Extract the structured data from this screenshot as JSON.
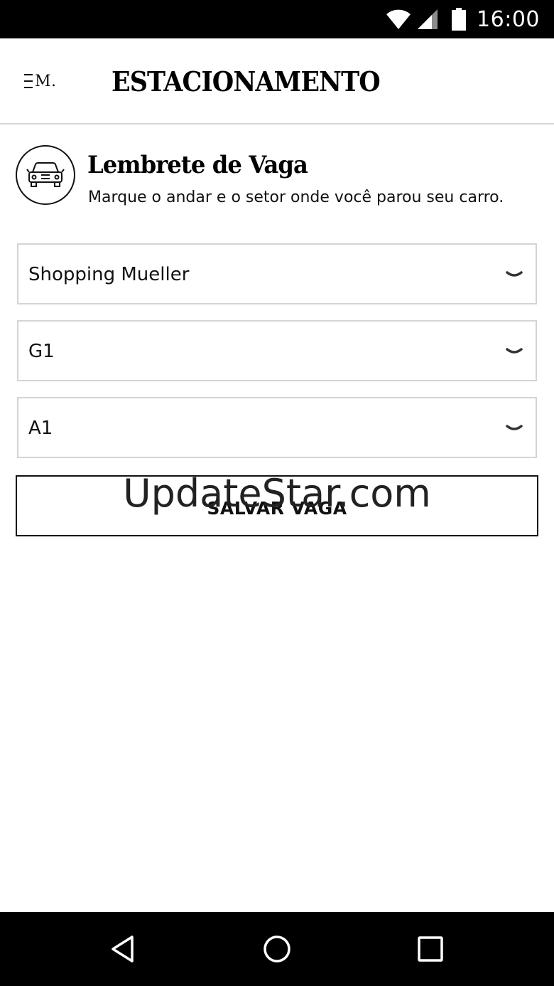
{
  "status_bar": {
    "time": "16:00",
    "icons": [
      "wifi-icon",
      "signal-icon",
      "battery-icon"
    ]
  },
  "header": {
    "logo_text": "M.",
    "title": "ESTACIONAMENTO",
    "menu_icon": "menu-icon"
  },
  "intro": {
    "icon": "car-icon",
    "title": "Lembrete de Vaga",
    "subtitle": "Marque o andar e o setor onde você parou seu carro."
  },
  "selects": {
    "mall": {
      "value": "Shopping Mueller"
    },
    "floor": {
      "value": "G1"
    },
    "sector": {
      "value": "A1"
    }
  },
  "save_button": {
    "label": "SALVAR VAGA"
  },
  "watermark": "UpdateStar.com",
  "nav_bar": {
    "icons": [
      "back-icon",
      "home-icon",
      "recent-apps-icon"
    ]
  },
  "colors": {
    "background": "#ffffff",
    "text": "#111111",
    "border": "#d4d4d4",
    "system_bars": "#000000"
  }
}
